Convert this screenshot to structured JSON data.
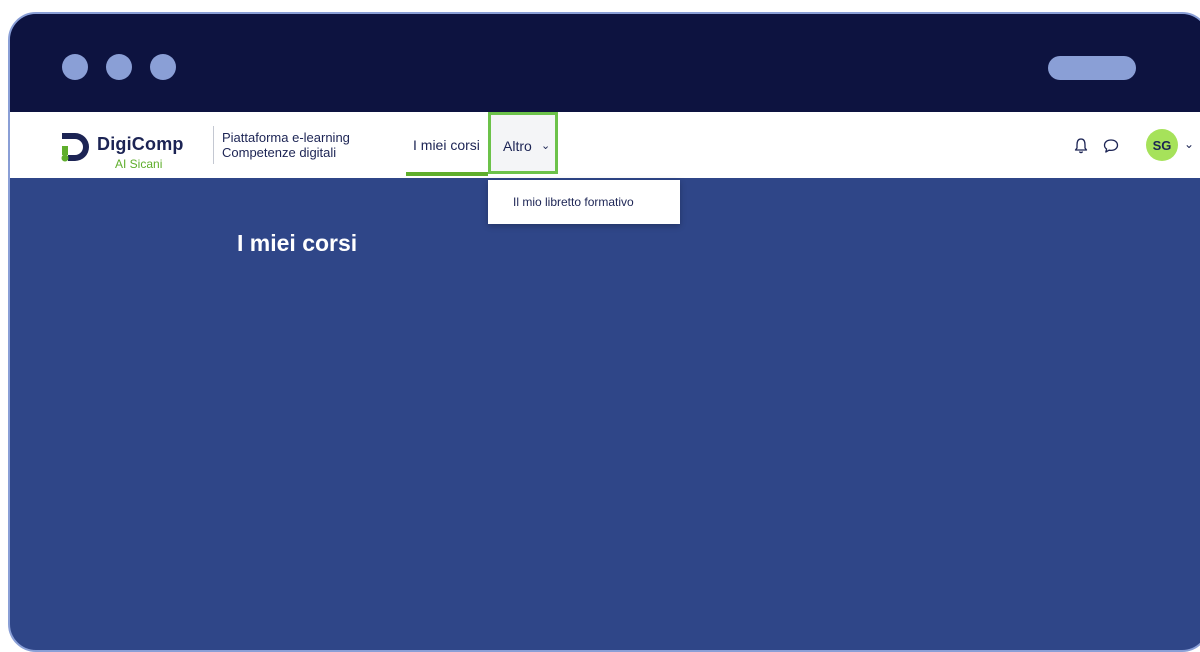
{
  "brand": {
    "name": "DigiComp",
    "subtitle": "AI Sicani",
    "tagline_line1": "Piattaforma e-learning",
    "tagline_line2": "Competenze digitali"
  },
  "nav": {
    "items": [
      {
        "label": "I miei corsi",
        "active": true
      },
      {
        "label": "Altro",
        "expanded": true
      }
    ],
    "altro_chevron": "⌄"
  },
  "dropdown": {
    "items": [
      {
        "label": "Il mio libretto formativo"
      }
    ]
  },
  "user": {
    "initials": "SG",
    "chevron": "⌄"
  },
  "icons": {
    "notifications": "bell-icon",
    "messages": "chat-icon"
  },
  "main": {
    "page_title": "I miei corsi"
  },
  "colors": {
    "titlebar": "#0d1340",
    "accent_green": "#6cc24a",
    "page_background": "#2f4688",
    "brand_navy": "#1c2454"
  }
}
